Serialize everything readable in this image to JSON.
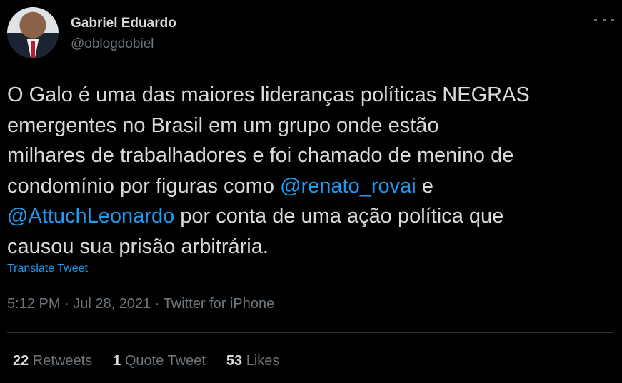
{
  "author": {
    "name": "Gabriel Eduardo",
    "handle": "@oblogdobiel"
  },
  "tweet": {
    "lines": [
      [
        {
          "text": "O Galo é uma das maiores lideranças políticas NEGRAS"
        }
      ],
      [
        {
          "text": "emergentes no Brasil em um grupo onde estão"
        }
      ],
      [
        {
          "text": "milhares de trabalhadores e foi chamado de menino de"
        }
      ],
      [
        {
          "text": "condomínio por figuras como "
        },
        {
          "text": "@renato_rovai",
          "mention": true
        },
        {
          "text": " e"
        }
      ],
      [
        {
          "text": "@AttuchLeonardo",
          "mention": true
        },
        {
          "text": " por conta de uma ação política que"
        }
      ],
      [
        {
          "text": "causou sua prisão arbitrária."
        }
      ]
    ]
  },
  "translate_label": "Translate Tweet",
  "meta": "5:12 PM · Jul 28, 2021 · Twitter for iPhone",
  "stats": [
    {
      "num": "22",
      "label": "Retweets"
    },
    {
      "num": "1",
      "label": "Quote Tweet"
    },
    {
      "num": "53",
      "label": "Likes"
    }
  ],
  "colors": {
    "background": "#000000",
    "text": "#d9d9d9",
    "secondary": "#6e767d",
    "accent": "#1d9bf0",
    "divider": "#2f3336"
  },
  "icons": [
    "more-options-icon"
  ]
}
